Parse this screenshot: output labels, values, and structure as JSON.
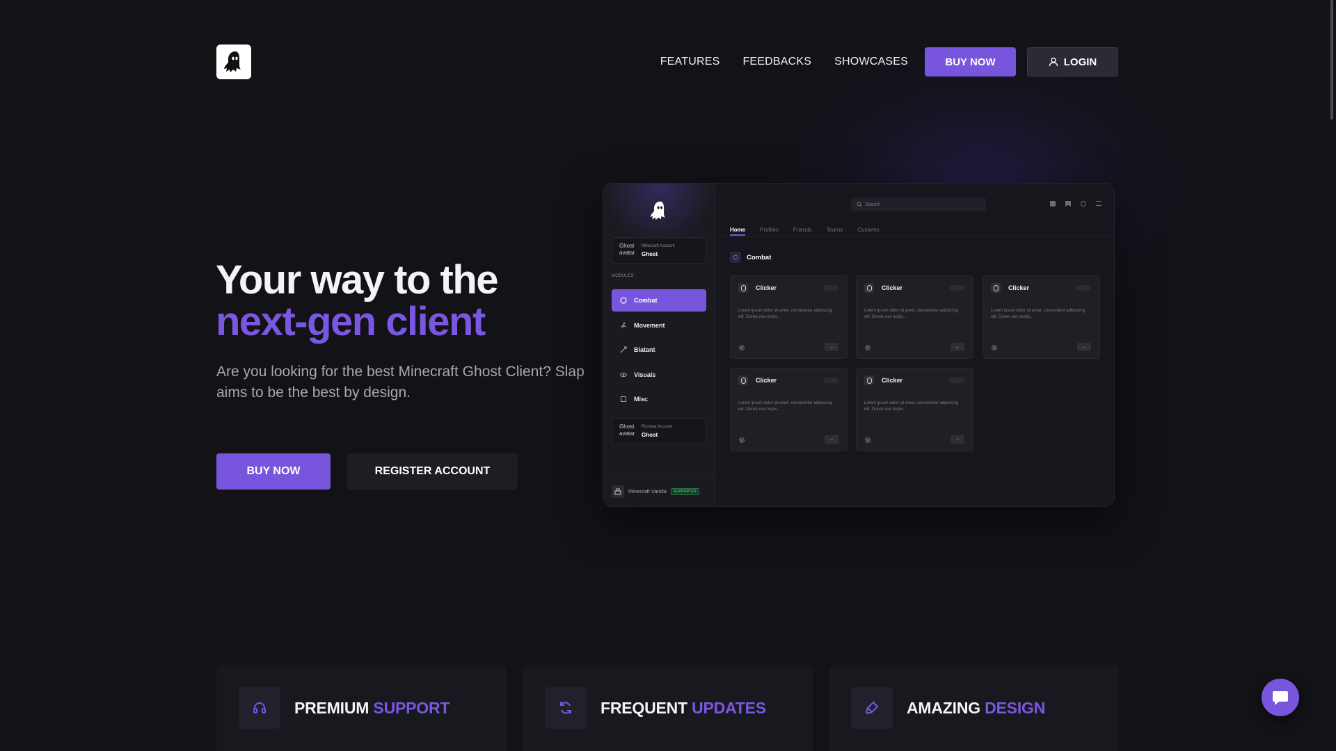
{
  "header": {
    "logo_icon": "ghost-icon",
    "nav": [
      "FEATURES",
      "FEEDBACKS",
      "SHOWCASES"
    ],
    "buy_now": "BUY NOW",
    "login": "LOGIN"
  },
  "hero": {
    "title_line1": "Your way to the",
    "title_line2": "next-gen client",
    "subtitle": "Are you looking for the best Minecraft Ghost Client? Slap aims to be the best by design.",
    "buy_now": "BUY NOW",
    "register": "REGISTER ACCOUNT"
  },
  "mockup": {
    "accounts": [
      {
        "avatar_alt": "Ghost avatar",
        "label": "Minecraft Account",
        "name": "Ghost"
      },
      {
        "avatar_alt": "Ghost avatar",
        "label": "Pixnova Account",
        "name": "Ghost"
      }
    ],
    "modules_label": "MODULES",
    "modules": [
      "Combat",
      "Movement",
      "Blatant",
      "Visuals",
      "Misc"
    ],
    "footer_text": "Minecraft Vanilla",
    "footer_badge": "SUPPORTED",
    "search_placeholder": "Search",
    "tabs": [
      "Home",
      "Profiles",
      "Friends",
      "Teams",
      "Customs"
    ],
    "section_title": "Combat",
    "cards": [
      {
        "title": "Clicker",
        "desc": "Lorem ipsum dolor sit amet, consectetur adipiscing elit. Donec nec turpis..."
      },
      {
        "title": "Clicker",
        "desc": "Lorem ipsum dolor sit amet, consectetur adipiscing elit. Donec nec turpis..."
      },
      {
        "title": "Clicker",
        "desc": "Lorem ipsum dolor sit amet, consectetur adipiscing elit. Donec nec turpis..."
      },
      {
        "title": "Clicker",
        "desc": "Lorem ipsum dolor sit amet, consectetur adipiscing elit. Donec nec turpis..."
      },
      {
        "title": "Clicker",
        "desc": "Lorem ipsum dolor sit amet, consectetur adipiscing elit. Donec nec turpis..."
      }
    ]
  },
  "features": [
    {
      "icon": "headset-icon",
      "title": "PREMIUM",
      "accent": "SUPPORT"
    },
    {
      "icon": "refresh-icon",
      "title": "FREQUENT",
      "accent": "UPDATES"
    },
    {
      "icon": "paint-brush-icon",
      "title": "AMAZING",
      "accent": "DESIGN"
    }
  ],
  "colors": {
    "background": "#121217",
    "accent": "#7756dd",
    "accent_text": "#7a57e0",
    "surface": "#18191e"
  },
  "chat": {
    "icon": "chat-bubble-icon"
  }
}
